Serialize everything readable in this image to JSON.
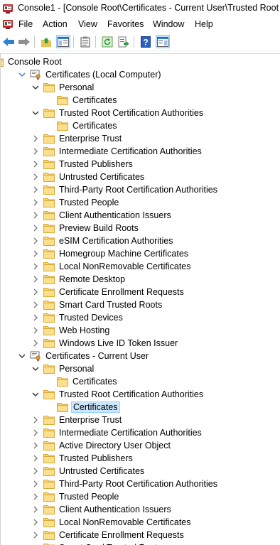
{
  "window": {
    "title": "Console1 - [Console Root\\Certificates - Current User\\Trusted Root Certification Authorities\\Certificates]"
  },
  "menu": [
    "File",
    "Action",
    "View",
    "Favorites",
    "Window",
    "Help"
  ],
  "toolbar": {
    "buttons": [
      {
        "name": "back-icon"
      },
      {
        "name": "forward-icon"
      },
      {
        "name": "up-folder-icon"
      },
      {
        "name": "show-hide-tree-icon"
      },
      {
        "name": "properties-icon"
      },
      {
        "name": "refresh-icon"
      },
      {
        "name": "export-list-icon"
      },
      {
        "name": "help-icon"
      },
      {
        "name": "show-hide-action-pane-icon"
      }
    ]
  },
  "tree": [
    {
      "label": "Console Root",
      "level": 0,
      "type": "folder",
      "chev": "none"
    },
    {
      "label": "Certificates (Local Computer)",
      "level": 1,
      "type": "cert",
      "chev": "open-blue"
    },
    {
      "label": "Personal",
      "level": 2,
      "type": "folder",
      "chev": "open"
    },
    {
      "label": "Certificates",
      "level": 3,
      "type": "folder",
      "chev": "none"
    },
    {
      "label": "Trusted Root Certification Authorities",
      "level": 2,
      "type": "folder",
      "chev": "open"
    },
    {
      "label": "Certificates",
      "level": 3,
      "type": "folder",
      "chev": "none"
    },
    {
      "label": "Enterprise Trust",
      "level": 2,
      "type": "folder",
      "chev": "closed"
    },
    {
      "label": "Intermediate Certification Authorities",
      "level": 2,
      "type": "folder",
      "chev": "closed"
    },
    {
      "label": "Trusted Publishers",
      "level": 2,
      "type": "folder",
      "chev": "closed"
    },
    {
      "label": "Untrusted Certificates",
      "level": 2,
      "type": "folder",
      "chev": "closed"
    },
    {
      "label": "Third-Party Root Certification Authorities",
      "level": 2,
      "type": "folder",
      "chev": "closed"
    },
    {
      "label": "Trusted People",
      "level": 2,
      "type": "folder",
      "chev": "closed"
    },
    {
      "label": "Client Authentication Issuers",
      "level": 2,
      "type": "folder",
      "chev": "closed"
    },
    {
      "label": "Preview Build Roots",
      "level": 2,
      "type": "folder",
      "chev": "closed"
    },
    {
      "label": "eSIM Certification Authorities",
      "level": 2,
      "type": "folder",
      "chev": "closed"
    },
    {
      "label": "Homegroup Machine Certificates",
      "level": 2,
      "type": "folder",
      "chev": "closed"
    },
    {
      "label": "Local NonRemovable Certificates",
      "level": 2,
      "type": "folder",
      "chev": "closed"
    },
    {
      "label": "Remote Desktop",
      "level": 2,
      "type": "folder",
      "chev": "closed"
    },
    {
      "label": "Certificate Enrollment Requests",
      "level": 2,
      "type": "folder",
      "chev": "closed"
    },
    {
      "label": "Smart Card Trusted Roots",
      "level": 2,
      "type": "folder",
      "chev": "closed"
    },
    {
      "label": "Trusted Devices",
      "level": 2,
      "type": "folder",
      "chev": "closed"
    },
    {
      "label": "Web Hosting",
      "level": 2,
      "type": "folder",
      "chev": "closed"
    },
    {
      "label": "Windows Live ID Token Issuer",
      "level": 2,
      "type": "folder",
      "chev": "closed"
    },
    {
      "label": "Certificates - Current User",
      "level": 1,
      "type": "cert",
      "chev": "open"
    },
    {
      "label": "Personal",
      "level": 2,
      "type": "folder",
      "chev": "open"
    },
    {
      "label": "Certificates",
      "level": 3,
      "type": "folder",
      "chev": "none"
    },
    {
      "label": "Trusted Root Certification Authorities",
      "level": 2,
      "type": "folder",
      "chev": "open"
    },
    {
      "label": "Certificates",
      "level": 3,
      "type": "folder",
      "chev": "none",
      "selected": true
    },
    {
      "label": "Enterprise Trust",
      "level": 2,
      "type": "folder",
      "chev": "closed"
    },
    {
      "label": "Intermediate Certification Authorities",
      "level": 2,
      "type": "folder",
      "chev": "closed"
    },
    {
      "label": "Active Directory User Object",
      "level": 2,
      "type": "folder",
      "chev": "closed"
    },
    {
      "label": "Trusted Publishers",
      "level": 2,
      "type": "folder",
      "chev": "closed"
    },
    {
      "label": "Untrusted Certificates",
      "level": 2,
      "type": "folder",
      "chev": "closed"
    },
    {
      "label": "Third-Party Root Certification Authorities",
      "level": 2,
      "type": "folder",
      "chev": "closed"
    },
    {
      "label": "Trusted People",
      "level": 2,
      "type": "folder",
      "chev": "closed"
    },
    {
      "label": "Client Authentication Issuers",
      "level": 2,
      "type": "folder",
      "chev": "closed"
    },
    {
      "label": "Local NonRemovable Certificates",
      "level": 2,
      "type": "folder",
      "chev": "closed"
    },
    {
      "label": "Certificate Enrollment Requests",
      "level": 2,
      "type": "folder",
      "chev": "closed"
    },
    {
      "label": "Smart Card Trusted Roots",
      "level": 2,
      "type": "folder",
      "chev": "closed"
    }
  ]
}
